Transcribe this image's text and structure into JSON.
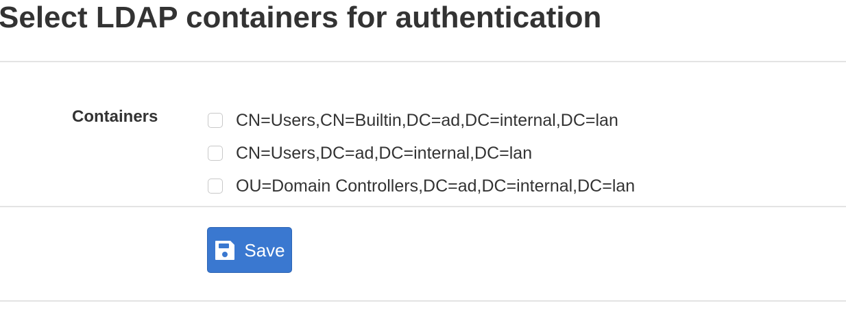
{
  "page": {
    "title": "Select LDAP containers for authentication"
  },
  "form": {
    "containers_label": "Containers",
    "containers": [
      {
        "label": "CN=Users,CN=Builtin,DC=ad,DC=internal,DC=lan",
        "checked": false
      },
      {
        "label": "CN=Users,DC=ad,DC=internal,DC=lan",
        "checked": false
      },
      {
        "label": "OU=Domain Controllers,DC=ad,DC=internal,DC=lan",
        "checked": false
      }
    ]
  },
  "actions": {
    "save_label": "Save",
    "save_icon": "floppy-disk-icon"
  },
  "colors": {
    "primary": "#3a78d0",
    "text": "#333333",
    "divider": "#e3e3e3"
  }
}
